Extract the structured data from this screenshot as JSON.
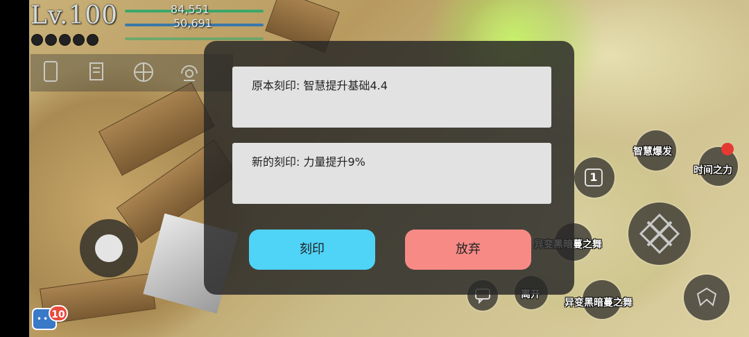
{
  "hud": {
    "level": "Lv.100",
    "hp_value": "84,551",
    "mp_value": "50,691",
    "colors": {
      "hp_bar": "#3aa86a",
      "mp_bar": "#3a78a8"
    }
  },
  "dialog": {
    "original_inscription": "原本刻印: 智慧提升基础4.4",
    "new_inscription": "新的刻印: 力量提升9%",
    "inscribe_button": "刻印",
    "abandon_button": "放弃",
    "colors": {
      "inscribe": "#4fd3f6",
      "abandon": "#f88a86"
    }
  },
  "skills": {
    "wisdom_burst": "智慧爆发",
    "time_power": "时间之力",
    "slot_number": "1",
    "mutation_dance_1": "异变黑暗蔓之舞",
    "leave": "离开",
    "mutation_dance_2": "异变黑暗蔓之舞"
  },
  "chat": {
    "unread_count": "10"
  },
  "icons": [
    "phone-icon",
    "scroll-icon",
    "crosshair-icon",
    "headset-icon",
    "chat-icon",
    "sword-emblem-icon",
    "wing-icon"
  ]
}
